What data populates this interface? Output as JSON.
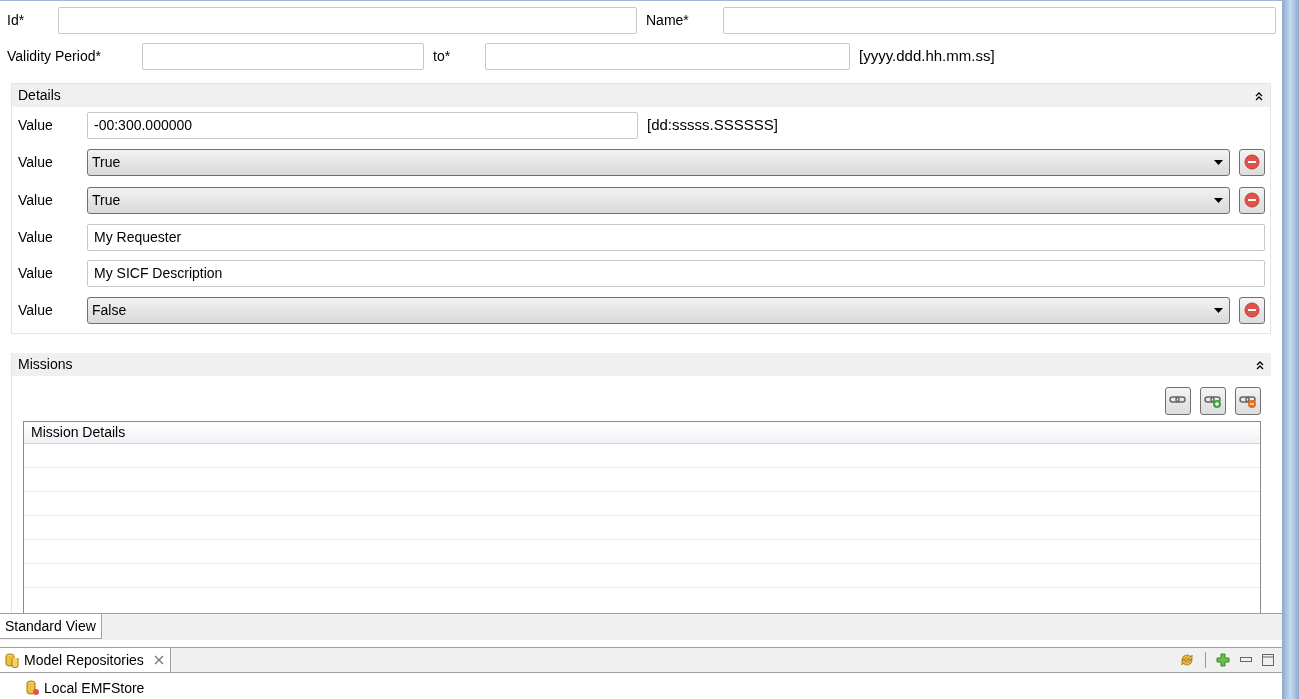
{
  "form": {
    "id_label": "Id*",
    "name_label": "Name*",
    "validity_label": "Validity Period*",
    "to_label": "to*",
    "date_format": "[yyyy.ddd.hh.mm.ss]"
  },
  "details": {
    "title": "Details",
    "rows": [
      {
        "kind": "text",
        "label": "Value",
        "value": "-00:300.000000",
        "format": "[dd:sssss.SSSSSS]"
      },
      {
        "kind": "select",
        "label": "Value",
        "value": "True"
      },
      {
        "kind": "select",
        "label": "Value",
        "value": "True"
      },
      {
        "kind": "text",
        "label": "Value",
        "value": "My Requester"
      },
      {
        "kind": "text",
        "label": "Value",
        "value": "My SICF Description"
      },
      {
        "kind": "select",
        "label": "Value",
        "value": "False"
      }
    ]
  },
  "missions": {
    "title": "Missions",
    "table": {
      "columns": [
        "Mission Details"
      ]
    }
  },
  "editor_tabs": [
    {
      "label": "Standard View",
      "selected": true
    }
  ],
  "view": {
    "tabs": [
      {
        "label": "Model Repositories",
        "selected": true
      }
    ],
    "tree": [
      {
        "label": "Local EMFStore"
      }
    ]
  }
}
